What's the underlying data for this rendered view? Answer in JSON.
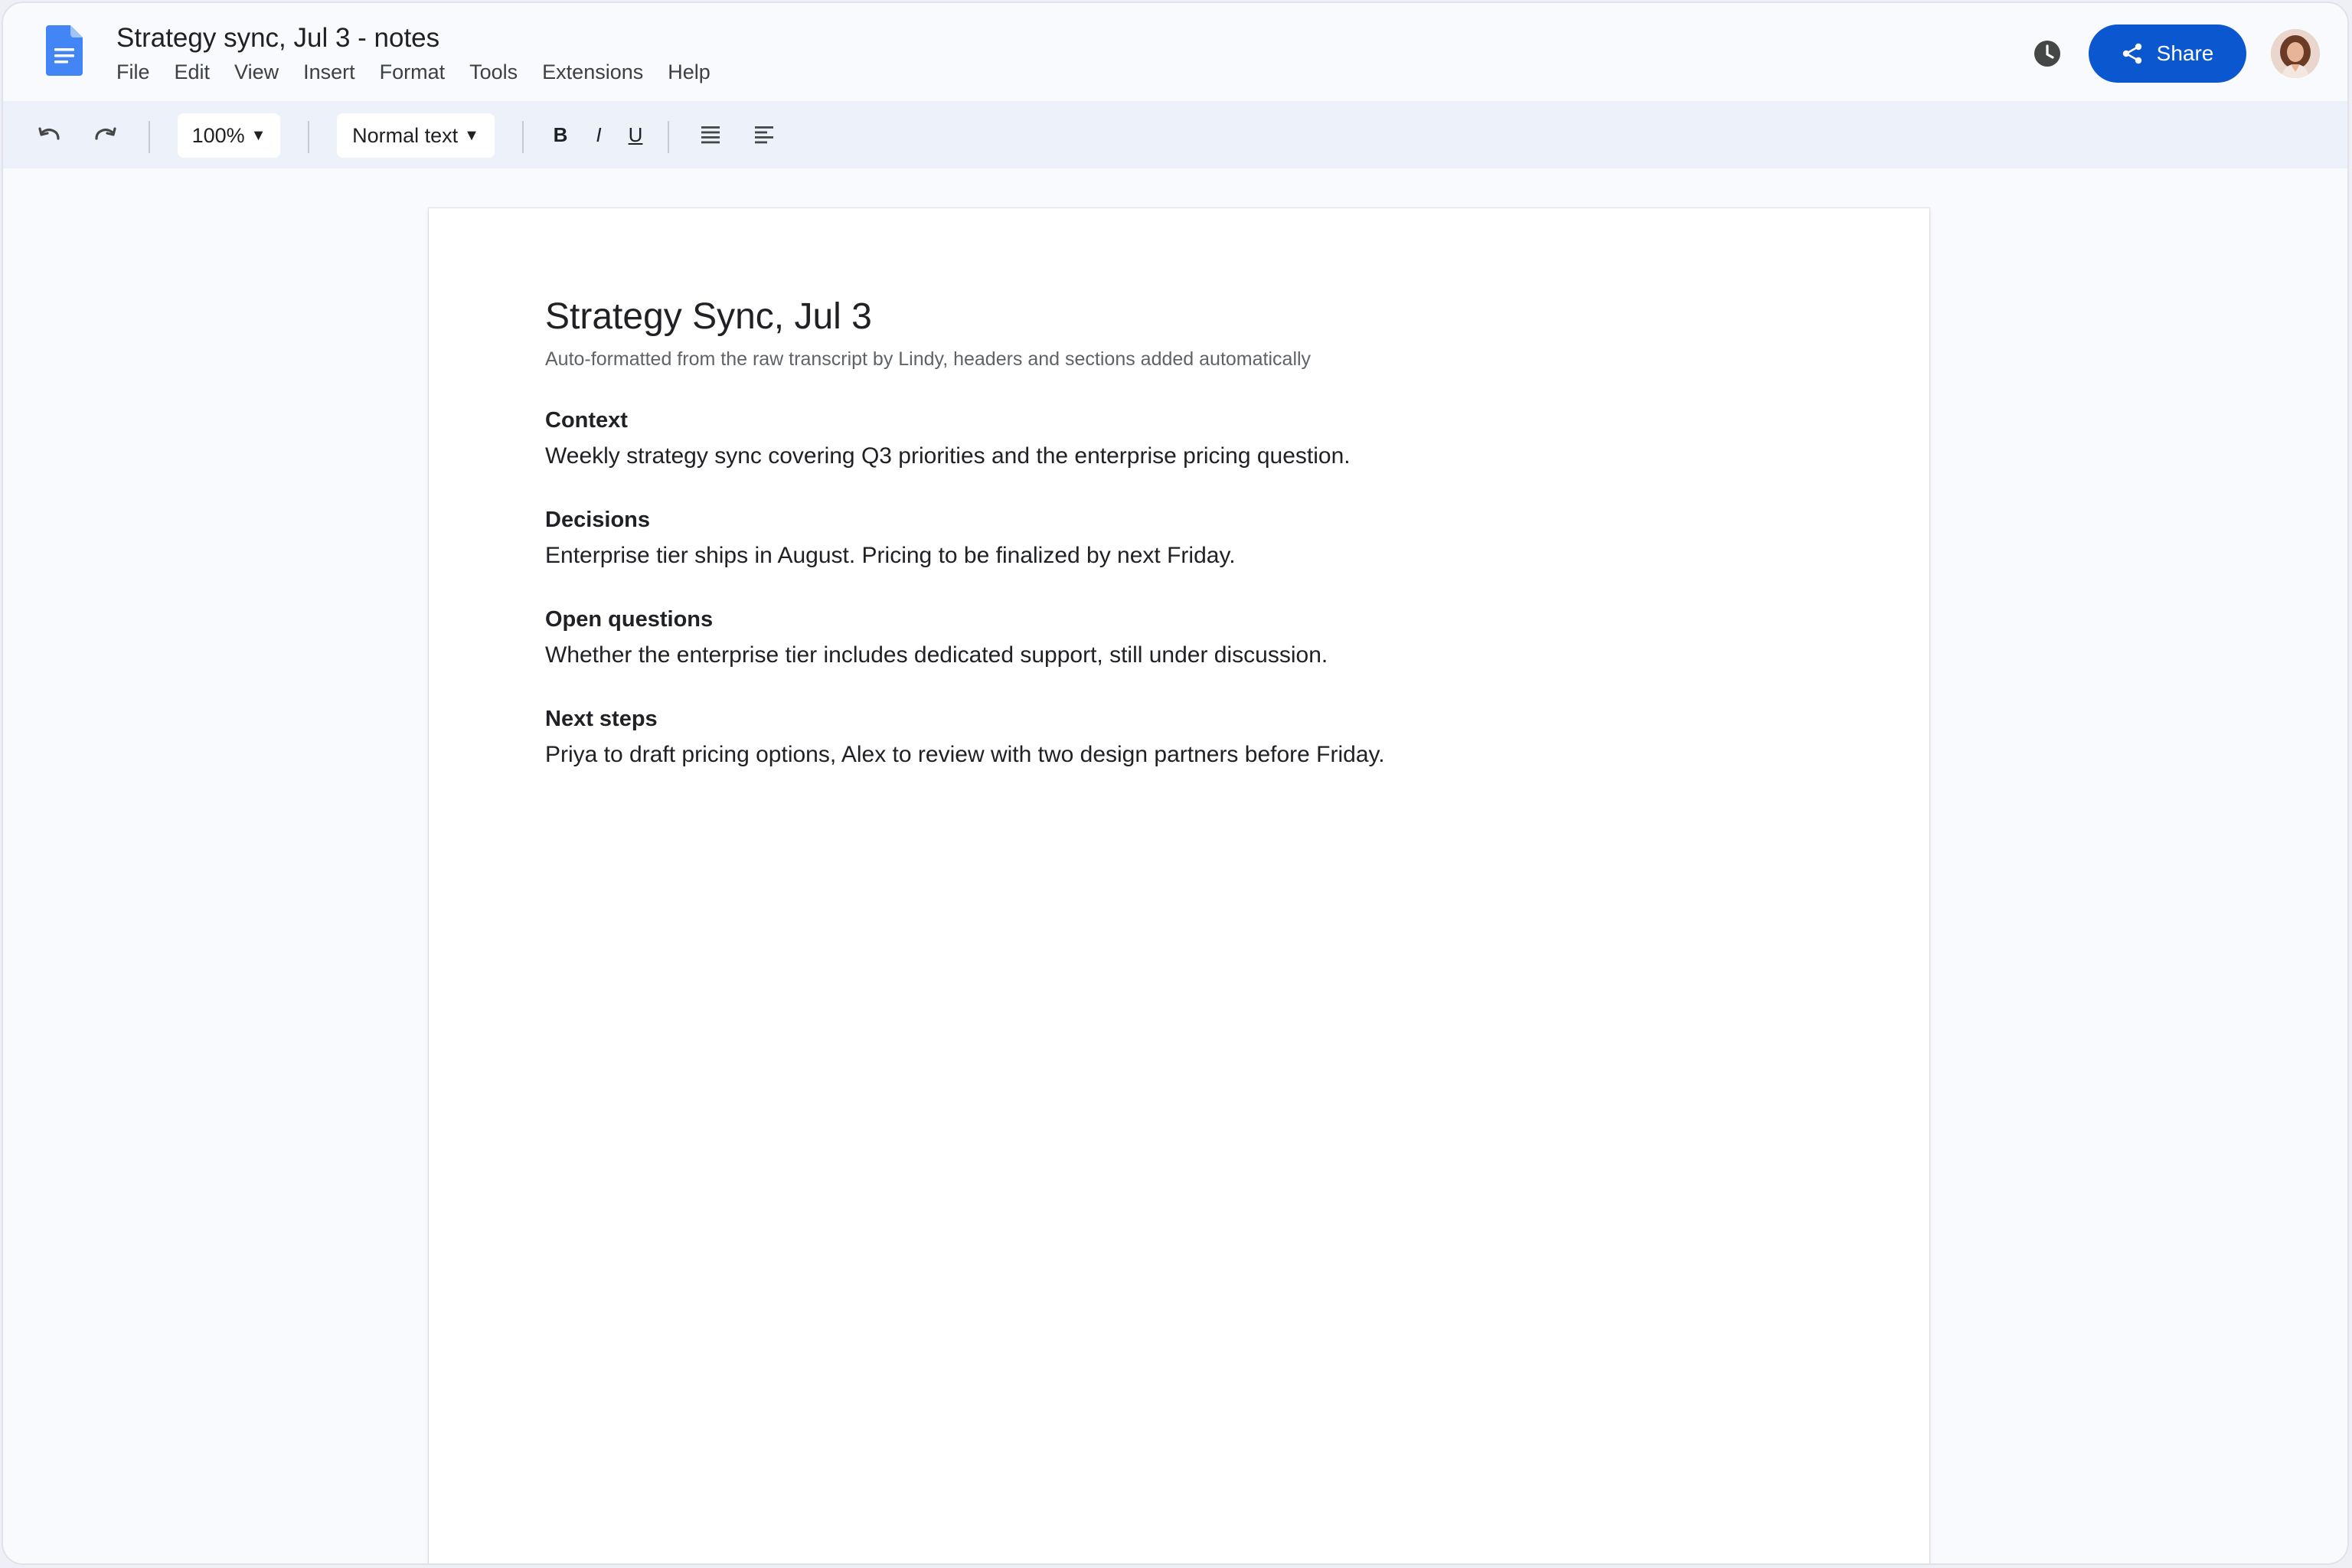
{
  "window": {
    "doc_title": "Strategy sync, Jul 3 - notes",
    "menu": [
      "File",
      "Edit",
      "View",
      "Insert",
      "Format",
      "Tools",
      "Extensions",
      "Help"
    ],
    "share_label": "Share",
    "accent_color": "#0b57d0"
  },
  "toolbar": {
    "zoom": "100%",
    "style": "Normal text",
    "bold": "B",
    "italic": "I",
    "underline": "U",
    "icons": [
      "undo-icon",
      "redo-icon",
      "align-justify-icon",
      "align-left-icon"
    ]
  },
  "document": {
    "heading": "Strategy Sync, Jul 3",
    "subtitle": "Auto-formatted from the raw transcript by Lindy, headers and sections added automatically",
    "sections": [
      {
        "title": "Context",
        "body": "Weekly strategy sync covering Q3 priorities and the enterprise pricing question."
      },
      {
        "title": "Decisions",
        "body": "Enterprise tier ships in August. Pricing to be finalized by next Friday."
      },
      {
        "title": "Open questions",
        "body": "Whether the enterprise tier includes dedicated support, still under discussion."
      },
      {
        "title": "Next steps",
        "body": "Priya to draft pricing options, Alex to review with two design partners before Friday."
      }
    ]
  }
}
